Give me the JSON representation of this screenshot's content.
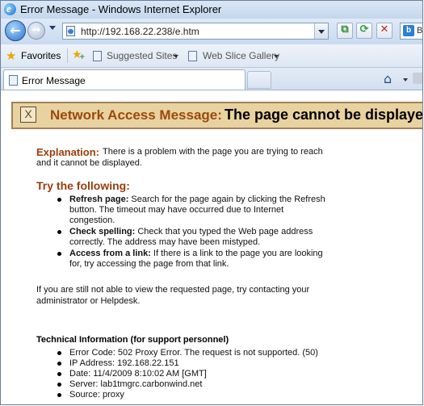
{
  "window": {
    "title": "Error Message - Windows Internet Explorer"
  },
  "nav": {
    "address": "http://192.168.22.238/e.htm",
    "search_label": "B"
  },
  "favorites_bar": {
    "favorites": "Favorites",
    "suggested": "Suggested Sites",
    "web_slice": "Web Slice Gallery"
  },
  "tab": {
    "title": "Error Message"
  },
  "page": {
    "banner": {
      "icon_char": "X",
      "label": "Network Access Message:",
      "message": "The page cannot be displayed"
    },
    "explanation": {
      "label": "Explanation:",
      "text": "There is a problem with the page you are trying to reach and it cannot be displayed."
    },
    "try_heading": "Try the following:",
    "tips": [
      {
        "label": "Refresh page:",
        "text": " Search for the page again by clicking the Refresh button. The timeout may have occurred due to Internet congestion."
      },
      {
        "label": "Check spelling:",
        "text": " Check that you typed the Web page address correctly. The address may have been mistyped."
      },
      {
        "label": "Access from a link:",
        "text": " If there is a link to the page you are looking for, try accessing the page from that link."
      }
    ],
    "still_text": "If you are still not able to view the requested page, try contacting your administrator or Helpdesk.",
    "tech_heading": "Technical Information (for support personnel)",
    "tech_items": [
      "Error Code: 502 Proxy Error. The request is not supported. (50)",
      "IP Address: 192.168.22.151",
      "Date: 11/4/2009 8:10:02 AM [GMT]",
      "Server: lab1tmgrc.carbonwind.net",
      "Source: proxy"
    ]
  }
}
